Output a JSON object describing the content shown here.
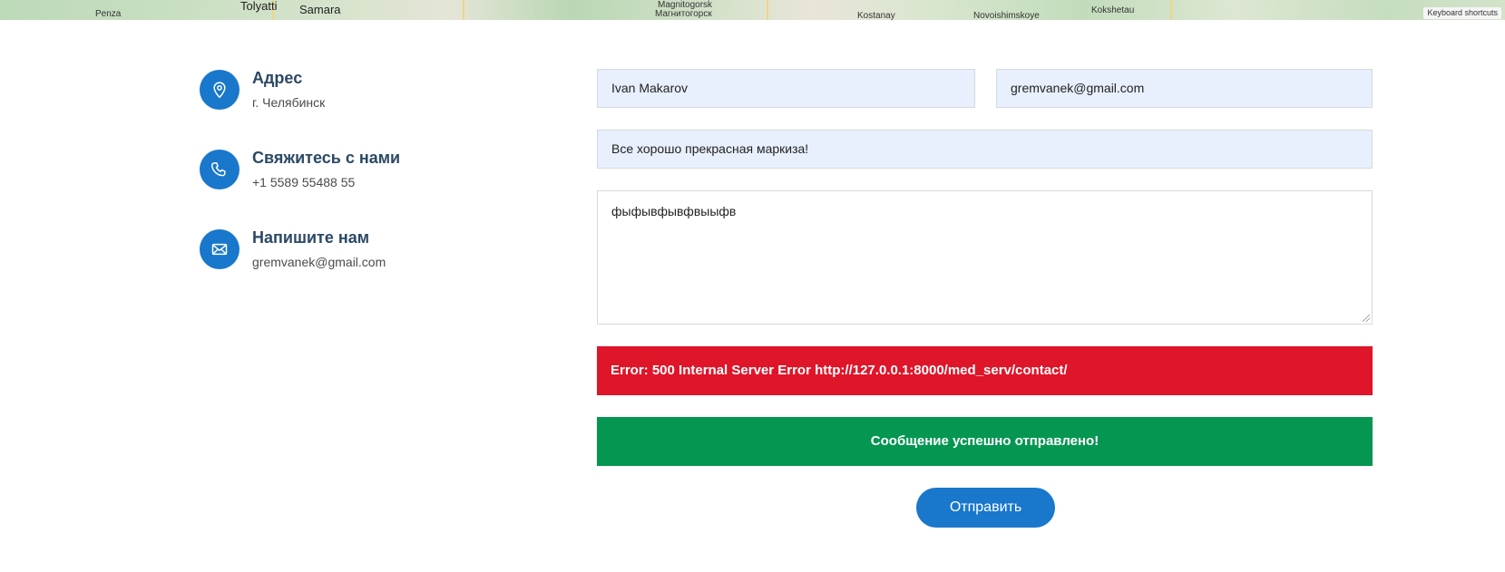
{
  "map": {
    "labels": [
      {
        "text": "Penza"
      },
      {
        "text": "Tolyatti"
      },
      {
        "text": "Samara"
      },
      {
        "text": "Magnitogorsk"
      },
      {
        "text": "Магнитогорск"
      },
      {
        "text": "Kostanay"
      },
      {
        "text": "Novoishimskoye"
      },
      {
        "text": "Kokshetau"
      }
    ],
    "keyboard_shortcuts": "Keyboard shortcuts"
  },
  "info": {
    "items": [
      {
        "title": "Адрес",
        "text": "г. Челябинск",
        "icon": "map-pin-icon"
      },
      {
        "title": "Свяжитесь с нами",
        "text": "+1 5589 55488 55",
        "icon": "phone-icon"
      },
      {
        "title": "Напишите нам",
        "text": "gremvanek@gmail.com",
        "icon": "envelope-icon"
      }
    ]
  },
  "form": {
    "name_value": "Ivan Makarov",
    "email_value": "gremvanek@gmail.com",
    "subject_value": "Все хорошо прекрасная маркиза!",
    "message_value": "фыфывфывфвыыфв",
    "error_message": "Error: 500 Internal Server Error http://127.0.0.1:8000/med_serv/contact/",
    "success_message": "Сообщение успешно отправлено!",
    "submit_label": "Отправить"
  },
  "colors": {
    "accent": "#1977cc",
    "heading": "#2c4964",
    "error": "#df1529",
    "success": "#059652",
    "autofill": "#e8f0fe"
  }
}
